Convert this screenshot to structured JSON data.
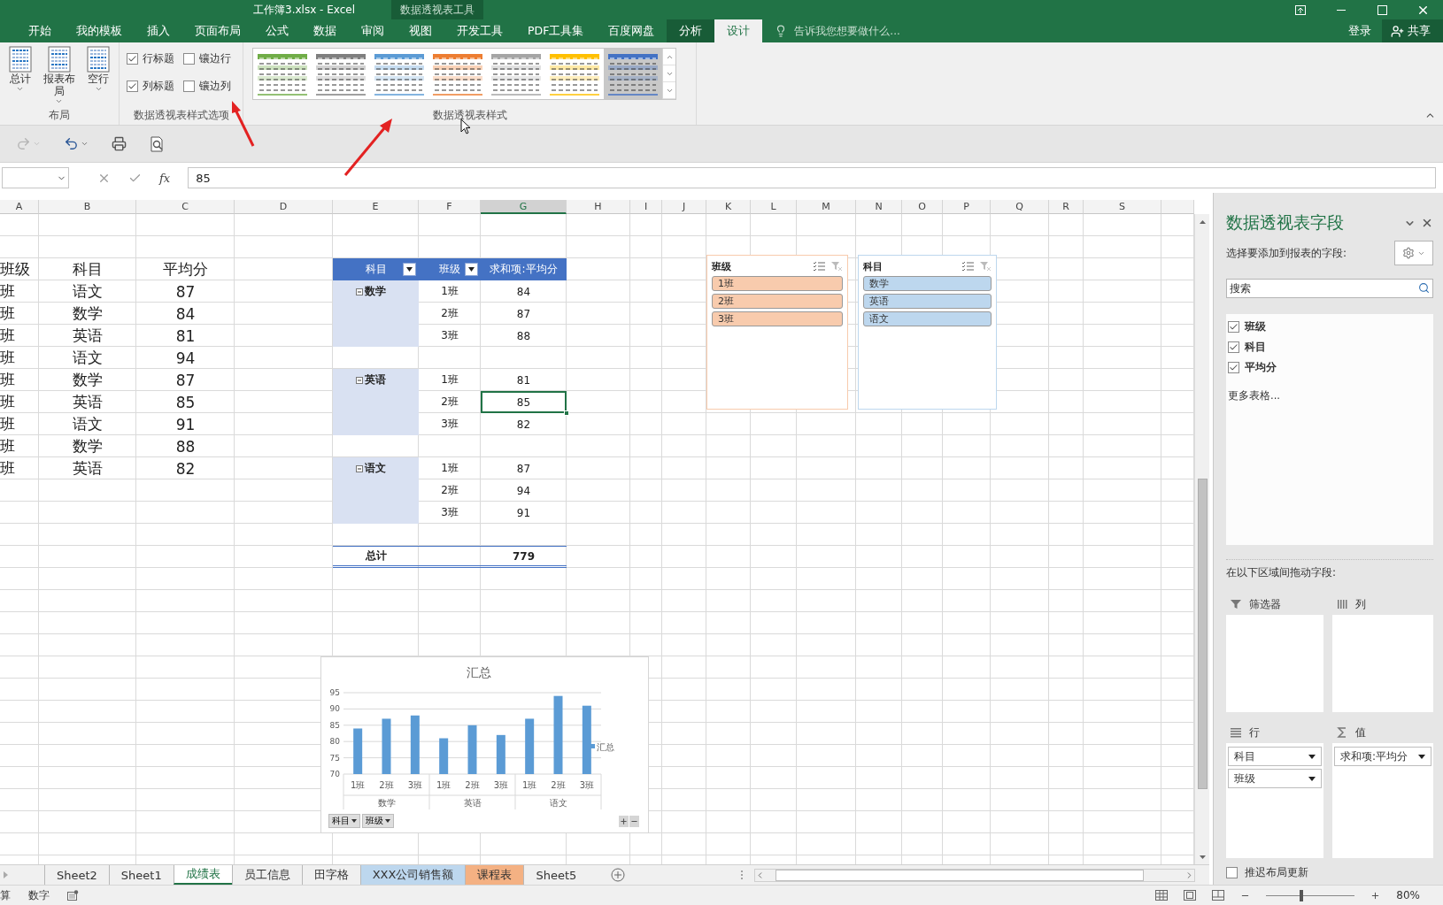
{
  "window": {
    "title": "工作簿3.xlsx - Excel",
    "context_label": "数据透视表工具"
  },
  "ribbon_tabs": [
    {
      "label": "开始",
      "selected": false,
      "kind": "standard"
    },
    {
      "label": "我的模板",
      "selected": false,
      "kind": "standard"
    },
    {
      "label": "插入",
      "selected": false,
      "kind": "standard"
    },
    {
      "label": "页面布局",
      "selected": false,
      "kind": "standard"
    },
    {
      "label": "公式",
      "selected": false,
      "kind": "standard"
    },
    {
      "label": "数据",
      "selected": false,
      "kind": "standard"
    },
    {
      "label": "审阅",
      "selected": false,
      "kind": "standard"
    },
    {
      "label": "视图",
      "selected": false,
      "kind": "standard"
    },
    {
      "label": "开发工具",
      "selected": false,
      "kind": "standard"
    },
    {
      "label": "PDF工具集",
      "selected": false,
      "kind": "standard"
    },
    {
      "label": "百度网盘",
      "selected": false,
      "kind": "standard"
    },
    {
      "label": "分析",
      "selected": false,
      "kind": "contextual"
    },
    {
      "label": "设计",
      "selected": true,
      "kind": "contextual"
    }
  ],
  "tell_me": {
    "placeholder": "告诉我您想要做什么..."
  },
  "account": {
    "sign_in": "登录",
    "share": "共享"
  },
  "ribbon": {
    "layout_group": {
      "label": "布局",
      "buttons": [
        {
          "label": "总计",
          "menu": true
        },
        {
          "label": "报表布局",
          "menu": true
        },
        {
          "label": "空行",
          "menu": true
        }
      ]
    },
    "options_group": {
      "label": "数据透视表样式选项",
      "options": [
        {
          "label": "行标题",
          "checked": true
        },
        {
          "label": "镶边行",
          "checked": false
        },
        {
          "label": "列标题",
          "checked": true
        },
        {
          "label": "镶边列",
          "checked": false
        }
      ]
    },
    "styles_group": {
      "label": "数据透视表样式",
      "styles": [
        {
          "color": "#70ad47",
          "selected": false
        },
        {
          "color": "#7f7f7f",
          "selected": false
        },
        {
          "color": "#5b9bd5",
          "selected": false
        },
        {
          "color": "#ed7d31",
          "selected": false
        },
        {
          "color": "#a5a5a5",
          "selected": false
        },
        {
          "color": "#ffc000",
          "selected": false
        },
        {
          "color": "#4472c4",
          "selected": true
        }
      ]
    }
  },
  "quick_access": [
    {
      "kind": "redo",
      "disabled": true
    },
    {
      "kind": "undo",
      "disabled": false
    },
    {
      "kind": "print",
      "disabled": false
    },
    {
      "kind": "print_preview",
      "disabled": false
    }
  ],
  "formula_bar": {
    "fx_label": "fx",
    "value": "85"
  },
  "sheet": {
    "columns": [
      {
        "label": "A",
        "selected": false
      },
      {
        "label": "B",
        "selected": false
      },
      {
        "label": "C",
        "selected": false
      },
      {
        "label": "D",
        "selected": false
      },
      {
        "label": "E",
        "selected": false
      },
      {
        "label": "F",
        "selected": false
      },
      {
        "label": "G",
        "selected": true
      },
      {
        "label": "H",
        "selected": false
      },
      {
        "label": "I",
        "selected": false
      },
      {
        "label": "J",
        "selected": false
      },
      {
        "label": "K",
        "selected": false
      },
      {
        "label": "L",
        "selected": false
      },
      {
        "label": "M",
        "selected": false
      },
      {
        "label": "N",
        "selected": false
      },
      {
        "label": "O",
        "selected": false
      },
      {
        "label": "P",
        "selected": false
      },
      {
        "label": "Q",
        "selected": false
      },
      {
        "label": "R",
        "selected": false
      },
      {
        "label": "S",
        "selected": false
      }
    ],
    "source_table": {
      "header": [
        "班级",
        "科目",
        "平均分"
      ],
      "rows": [
        [
          "班",
          "语文",
          "87"
        ],
        [
          "班",
          "数学",
          "84"
        ],
        [
          "班",
          "英语",
          "81"
        ],
        [
          "班",
          "语文",
          "94"
        ],
        [
          "班",
          "数学",
          "87"
        ],
        [
          "班",
          "英语",
          "85"
        ],
        [
          "班",
          "语文",
          "91"
        ],
        [
          "班",
          "数学",
          "88"
        ],
        [
          "班",
          "英语",
          "82"
        ]
      ]
    },
    "pivot_table": {
      "headers": [
        {
          "label": "科目",
          "filter": true
        },
        {
          "label": "班级",
          "filter": true
        },
        {
          "label": "求和项:平均分",
          "filter": false
        }
      ],
      "groups": [
        {
          "name": "数学",
          "expanded": true,
          "rows": [
            {
              "class": "1班",
              "value": "84",
              "selected": false
            },
            {
              "class": "2班",
              "value": "87",
              "selected": false
            },
            {
              "class": "3班",
              "value": "88",
              "selected": false
            }
          ]
        },
        {
          "name": "英语",
          "expanded": true,
          "rows": [
            {
              "class": "1班",
              "value": "81",
              "selected": false
            },
            {
              "class": "2班",
              "value": "85",
              "selected": true
            },
            {
              "class": "3班",
              "value": "82",
              "selected": false
            }
          ]
        },
        {
          "name": "语文",
          "expanded": true,
          "rows": [
            {
              "class": "1班",
              "value": "87",
              "selected": false
            },
            {
              "class": "2班",
              "value": "94",
              "selected": false
            },
            {
              "class": "3班",
              "value": "91",
              "selected": false
            }
          ]
        }
      ],
      "total": {
        "label": "总计",
        "value": "779"
      }
    },
    "slicers": [
      {
        "title": "班级",
        "color": "#f8cbad",
        "items": [
          {
            "label": "1班",
            "selected": true
          },
          {
            "label": "2班",
            "selected": true
          },
          {
            "label": "3班",
            "selected": true
          }
        ]
      },
      {
        "title": "科目",
        "color": "#bdd7ee",
        "items": [
          {
            "label": "数学",
            "selected": true
          },
          {
            "label": "英语",
            "selected": true
          },
          {
            "label": "语文",
            "selected": true
          }
        ]
      }
    ],
    "chart": {
      "chart_data": {
        "type": "bar",
        "title": "汇总",
        "categories": [
          "1班",
          "2班",
          "3班",
          "1班",
          "2班",
          "3班",
          "1班",
          "2班",
          "3班"
        ],
        "series": [
          {
            "name": "汇总",
            "color": "#5b9bd5",
            "values": [
              84,
              87,
              88,
              81,
              85,
              82,
              87,
              94,
              91
            ]
          }
        ],
        "ylim": [
          70,
          95
        ],
        "yticks": [
          70,
          75,
          80,
          85,
          90,
          95
        ],
        "grid": true
      },
      "category_groups": [
        "数学",
        "英语",
        "语文"
      ],
      "field_buttons": [
        "科目",
        "班级"
      ]
    }
  },
  "sheet_tabs": [
    {
      "label": "Sheet2",
      "selected": false
    },
    {
      "label": "Sheet1",
      "selected": false
    },
    {
      "label": "成绩表",
      "selected": true
    },
    {
      "label": "员工信息",
      "selected": false
    },
    {
      "label": "田字格",
      "selected": false
    },
    {
      "label": "XXX公司销售额",
      "selected": false,
      "color": "#bdd7ee"
    },
    {
      "label": "课程表",
      "selected": false,
      "color": "#f4b183"
    },
    {
      "label": "Sheet5",
      "selected": false
    }
  ],
  "field_pane": {
    "title": "数据透视表字段",
    "subtitle": "选择要添加到报表的字段:",
    "search_placeholder": "搜索",
    "fields": [
      {
        "label": "班级",
        "checked": true
      },
      {
        "label": "科目",
        "checked": true
      },
      {
        "label": "平均分",
        "checked": true
      }
    ],
    "more_link": "更多表格...",
    "areas_label": "在以下区域间拖动字段:",
    "areas": [
      {
        "kind": "filters",
        "label": "筛选器"
      },
      {
        "kind": "columns",
        "label": "列"
      },
      {
        "kind": "rows",
        "label": "行",
        "fields": [
          "科目",
          "班级"
        ]
      },
      {
        "kind": "values",
        "label": "值",
        "fields": [
          "求和项:平均分"
        ]
      }
    ],
    "defer": {
      "label": "推迟布局更新",
      "checked": false
    }
  },
  "status_bar": {
    "items": [
      "算",
      "数字"
    ],
    "zoom": {
      "level": 0.4,
      "reading": "80%"
    }
  }
}
